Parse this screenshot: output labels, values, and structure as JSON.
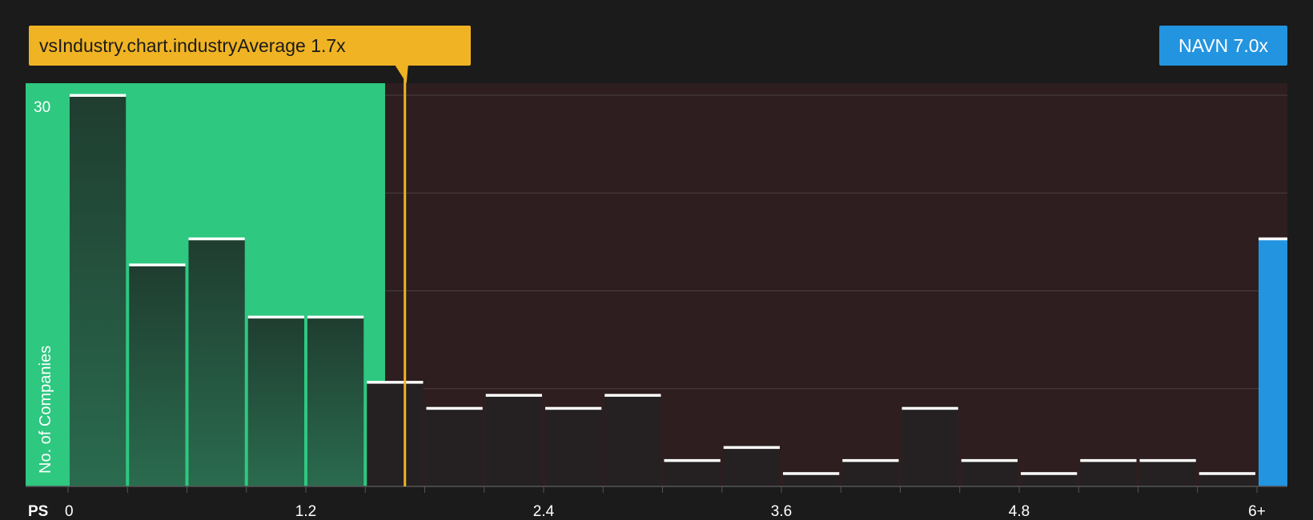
{
  "chart_data": {
    "type": "bar",
    "x_axis_label": "PS",
    "y_axis_label": "No. of Companies",
    "y_tick_labels": [
      {
        "value": 30,
        "label": "30"
      }
    ],
    "ylim": [
      0,
      31
    ],
    "y_gridlines": [
      7.5,
      15,
      22.5,
      30
    ],
    "x_ticks": [
      {
        "value": 0,
        "label": "0"
      },
      {
        "value": 1.2,
        "label": "1.2"
      },
      {
        "value": 2.4,
        "label": "2.4"
      },
      {
        "value": 3.6,
        "label": "3.6"
      },
      {
        "value": 4.8,
        "label": "4.8"
      },
      {
        "value": 6.0,
        "label": "6+"
      }
    ],
    "bin_width": 0.3,
    "bins": [
      {
        "x_start": 0.0,
        "value": 30
      },
      {
        "x_start": 0.3,
        "value": 17
      },
      {
        "x_start": 0.6,
        "value": 19
      },
      {
        "x_start": 0.9,
        "value": 13
      },
      {
        "x_start": 1.2,
        "value": 13
      },
      {
        "x_start": 1.5,
        "value": 8
      },
      {
        "x_start": 1.8,
        "value": 6
      },
      {
        "x_start": 2.1,
        "value": 7
      },
      {
        "x_start": 2.4,
        "value": 6
      },
      {
        "x_start": 2.7,
        "value": 7
      },
      {
        "x_start": 3.0,
        "value": 2
      },
      {
        "x_start": 3.3,
        "value": 3
      },
      {
        "x_start": 3.6,
        "value": 1
      },
      {
        "x_start": 3.9,
        "value": 2
      },
      {
        "x_start": 4.2,
        "value": 6
      },
      {
        "x_start": 4.5,
        "value": 2
      },
      {
        "x_start": 4.8,
        "value": 1
      },
      {
        "x_start": 5.1,
        "value": 2
      },
      {
        "x_start": 5.4,
        "value": 2
      },
      {
        "x_start": 5.7,
        "value": 1
      }
    ],
    "company_bin": {
      "label": "6+",
      "value": 19
    },
    "industry_average": {
      "value": 1.7,
      "label": "vsIndustry.chart.industryAverage 1.7x"
    },
    "company": {
      "ticker": "NAVN",
      "value": 7.0,
      "label": "NAVN 7.0x"
    },
    "fair_zone_upper": 1.6,
    "colors": {
      "background": "#1b1b1b",
      "green_zone": "#2ec880",
      "red_zone": "#2e1e1f",
      "bar_in_green_top": "#1f3d30",
      "bar_in_green_bottom": "#2a6b4e",
      "bar_in_red": "#252122",
      "bar_cap": "#ffffff",
      "average_line": "#f0b323",
      "company_bar": "#2394e0",
      "gridline": "#4a4040",
      "text": "#ffffff"
    }
  }
}
